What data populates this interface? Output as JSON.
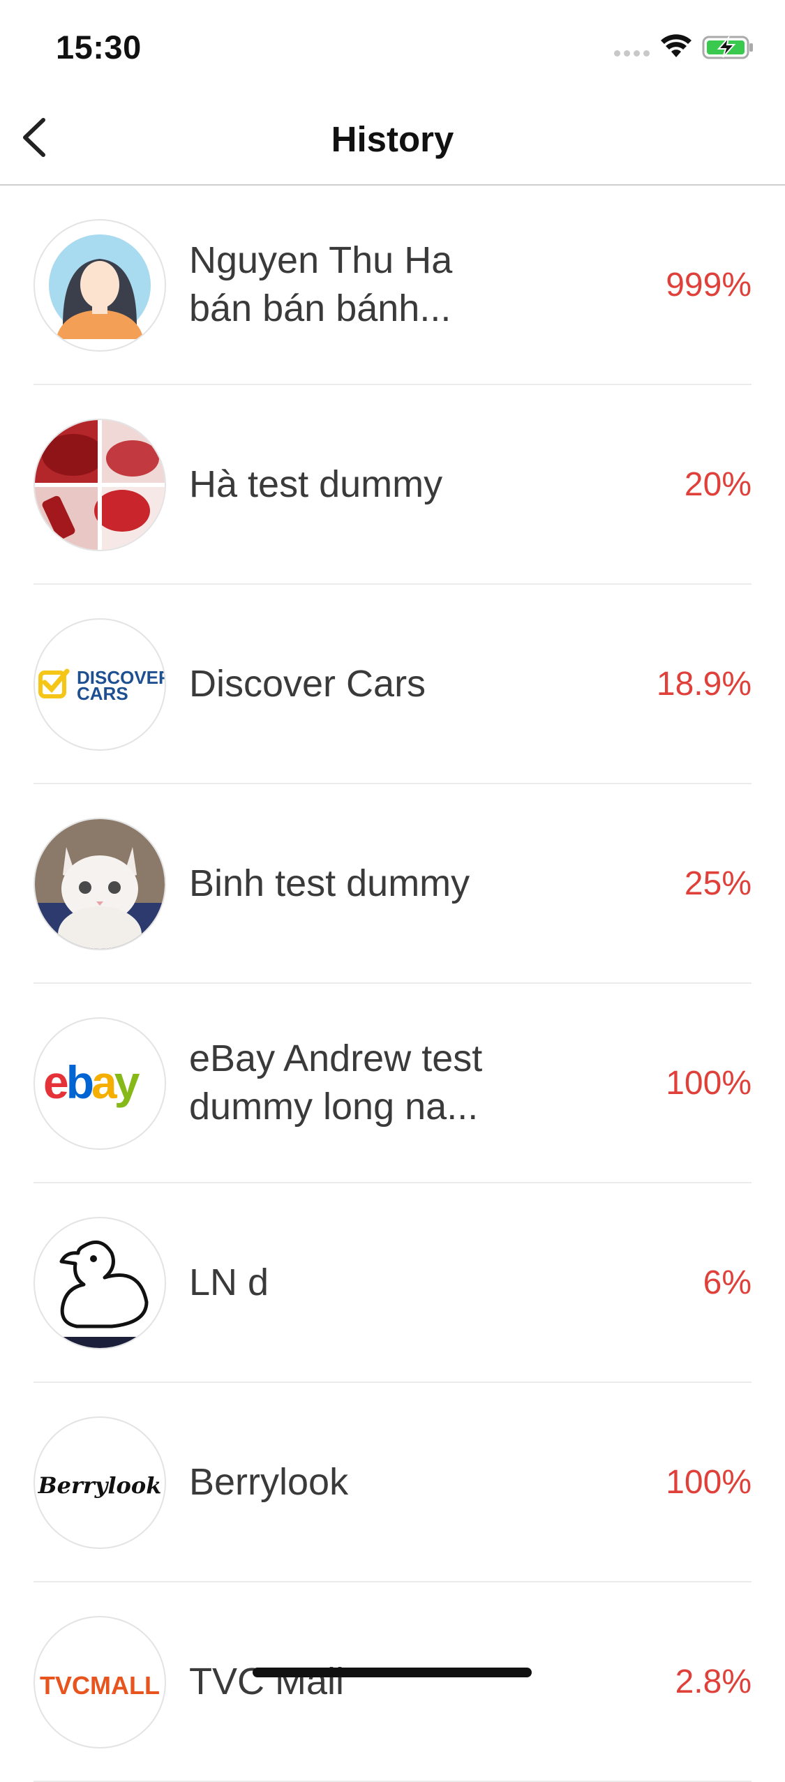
{
  "status_bar": {
    "time": "15:30"
  },
  "nav": {
    "title": "History"
  },
  "items": [
    {
      "name_line1": "Nguyen Thu Ha",
      "name_line2": "bán bán bánh...",
      "percent": "999%",
      "avatar": "woman-avatar"
    },
    {
      "name_line1": "Hà test dummy",
      "name_line2": "",
      "percent": "20%",
      "avatar": "lipstick-photo"
    },
    {
      "name_line1": "Discover Cars",
      "name_line2": "",
      "percent": "18.9%",
      "avatar": "discover-cars-logo"
    },
    {
      "name_line1": "Binh test dummy",
      "name_line2": "",
      "percent": "25%",
      "avatar": "kitten-photo"
    },
    {
      "name_line1": "eBay Andrew test",
      "name_line2": "dummy long na...",
      "percent": "100%",
      "avatar": "ebay-logo"
    },
    {
      "name_line1": "LN d",
      "name_line2": "",
      "percent": "6%",
      "avatar": "duck-logo"
    },
    {
      "name_line1": "Berrylook",
      "name_line2": "",
      "percent": "100%",
      "avatar": "berrylook-logo"
    },
    {
      "name_line1": "TVC Mall",
      "name_line2": "",
      "percent": "2.8%",
      "avatar": "tvcmall-logo"
    }
  ],
  "logos": {
    "discover_line1": "DISCOVER",
    "discover_line2": "CARS",
    "ebay": "ebay",
    "berrylook": "Berrylook",
    "tvcmall": "TVCMALL"
  },
  "colors": {
    "accent_percent": "#e0403a",
    "text": "#3a3a3a",
    "divider": "#ebebeb"
  }
}
